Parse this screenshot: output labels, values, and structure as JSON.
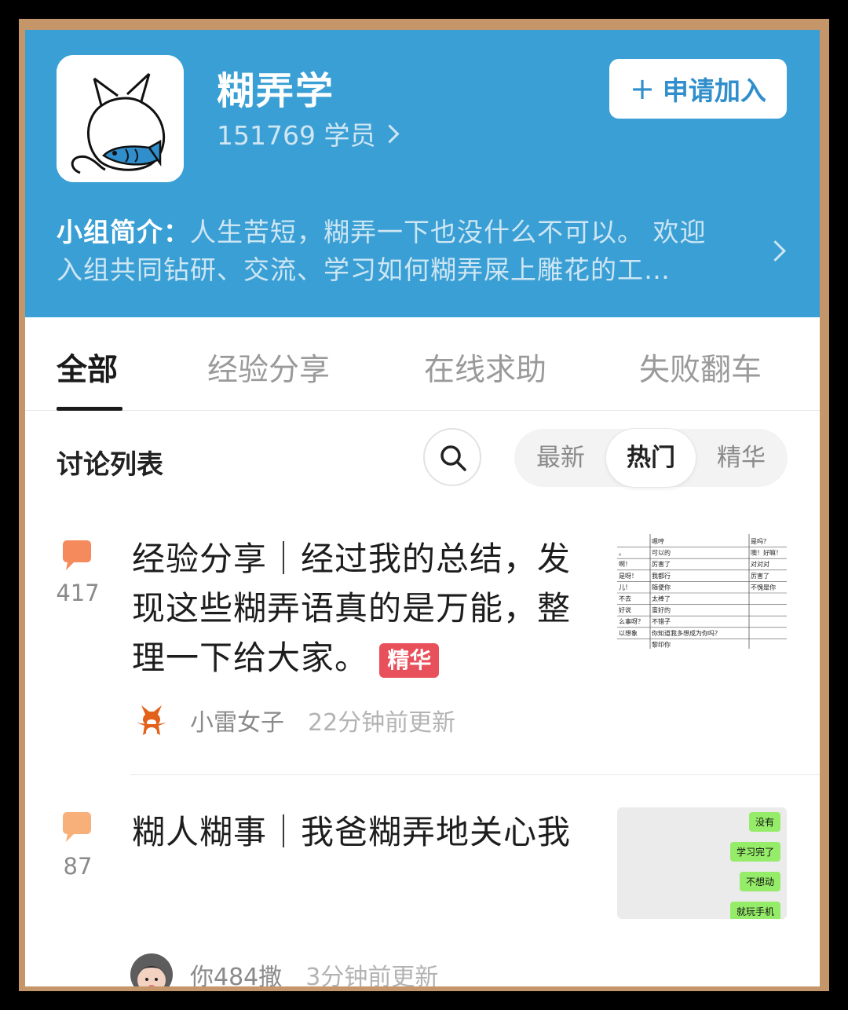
{
  "group": {
    "name": "糊弄学",
    "members": "151769 学员",
    "join_label": "申请加入",
    "join_plus": "+",
    "intro_label": "小组简介：",
    "intro_text": "人生苦短，糊弄一下也没什么不可以。 欢迎入组共同钻研、交流、学习如何糊弄屎上雕花的工…"
  },
  "tabs": [
    "全部",
    "经验分享",
    "在线求助",
    "失败翻车"
  ],
  "active_tab": "全部",
  "list": {
    "title": "讨论列表",
    "sort_options": [
      "最新",
      "热门",
      "精华"
    ],
    "active_sort": "热门"
  },
  "posts": [
    {
      "count": "417",
      "title": "经验分享｜经过我的总结，发现这些糊弄语真的是万能，整理一下给大家。",
      "badge": "精华",
      "author": "小雷女子",
      "time": "22分钟前更新",
      "thumb_rows": [
        [
          "",
          "嗯哼",
          "是吗？"
        ],
        [
          "。",
          "可以的",
          "噢！好嘛！"
        ],
        [
          "啊！",
          "厉害了",
          "对对对"
        ],
        [
          "是呀！",
          "我都行",
          "厉害了"
        ],
        [
          "儿！",
          "随便你",
          "不愧是你"
        ],
        [
          "不去",
          "太棒了",
          ""
        ],
        [
          "好说",
          "蛮好的",
          ""
        ],
        [
          "么事呀？",
          "不错子",
          ""
        ],
        [
          "以想象",
          "你知道我多想成为你吗？",
          ""
        ],
        [
          "",
          "黎印你",
          ""
        ]
      ]
    },
    {
      "count": "87",
      "title": "糊人糊事｜我爸糊弄地关心我",
      "author": "你484撒",
      "time": "3分钟前更新",
      "chat": [
        "没有",
        "学习完了",
        "不想动",
        "就玩手机"
      ]
    }
  ],
  "colors": {
    "header_bg": "#3a9fd4",
    "badge": "#e8505b",
    "bubble_1": "#f58a5c",
    "bubble_2": "#f8b07a",
    "chat_green": "#95ec69"
  }
}
